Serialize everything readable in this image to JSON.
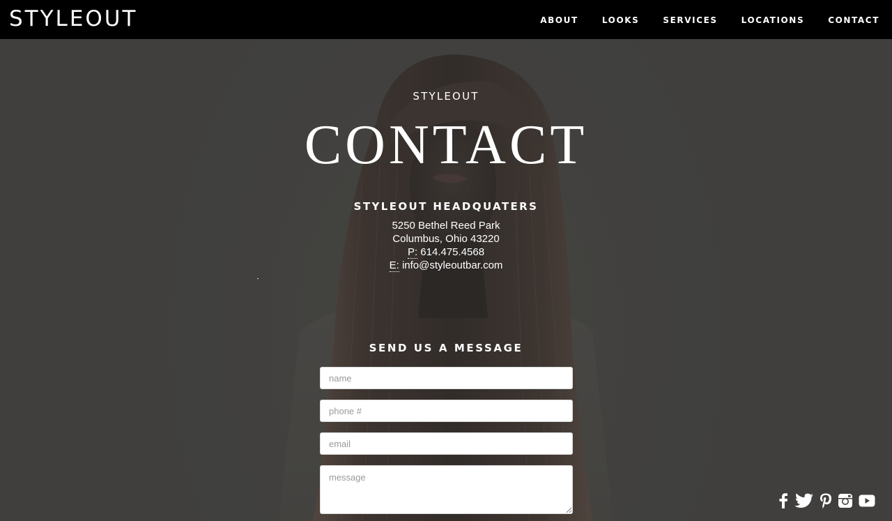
{
  "header": {
    "logo": "STYLEOUT",
    "nav": [
      "ABOUT",
      "LOOKS",
      "SERVICES",
      "LOCATIONS",
      "CONTACT"
    ]
  },
  "hero": {
    "eyebrow": "STYLEOUT",
    "title": "CONTACT"
  },
  "headquarters": {
    "heading": "STYLEOUT HEADQUATERS",
    "street": "5250 Bethel Reed Park",
    "city": "Columbus, Ohio 43220",
    "phone_label": "P:",
    "phone": "614.475.4568",
    "email_label": "E:",
    "email": "info@styleoutbar.com"
  },
  "form": {
    "heading": "SEND US A MESSAGE",
    "name_placeholder": "name",
    "phone_placeholder": "phone #",
    "email_placeholder": "email",
    "message_placeholder": "message"
  },
  "social": {
    "icons": [
      "facebook-icon",
      "twitter-icon",
      "pinterest-icon",
      "instagram-icon",
      "youtube-icon"
    ]
  },
  "colors": {
    "header_bg": "#000000",
    "overlay_bg": "#42413f",
    "text": "#ffffff"
  }
}
